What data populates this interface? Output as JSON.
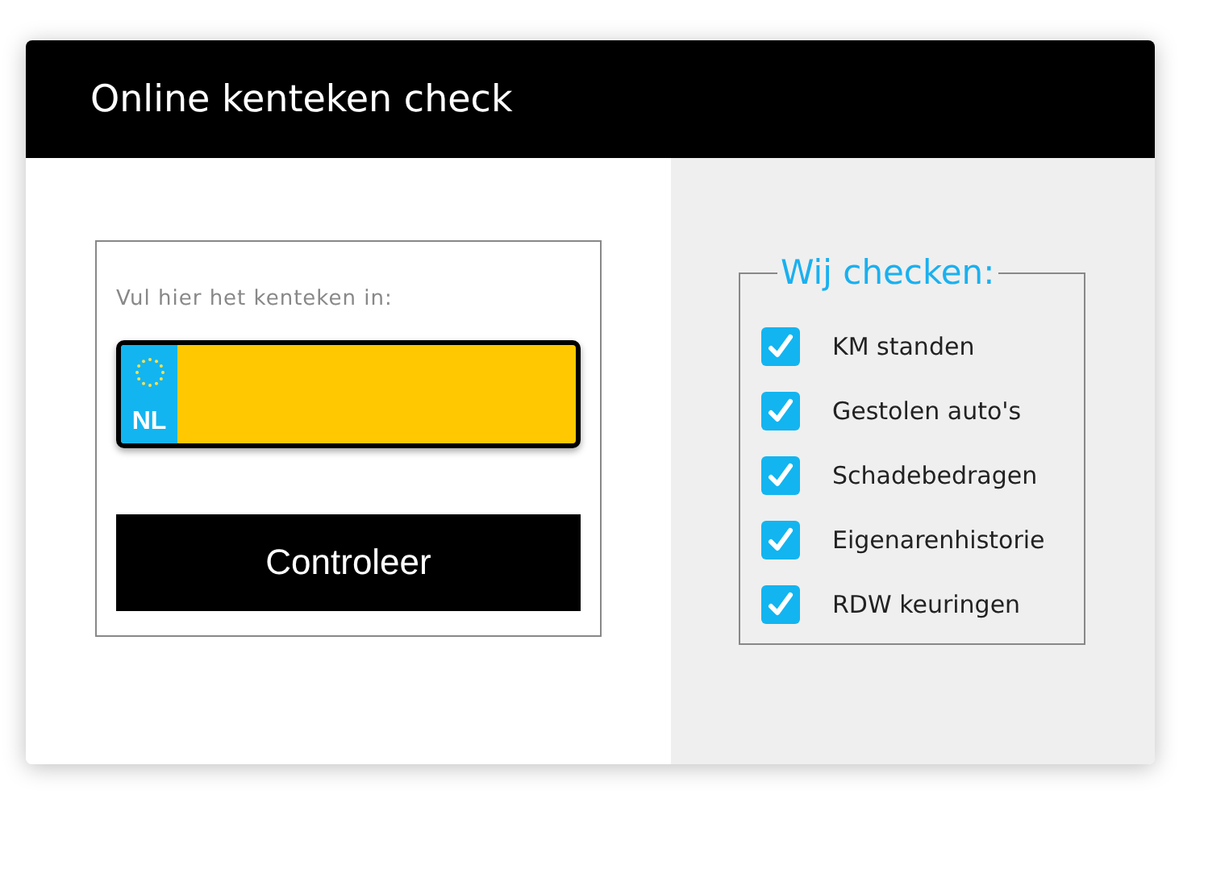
{
  "window": {
    "title": "Online kenteken check"
  },
  "form": {
    "label": "Vul hier het kenteken in:",
    "plate": {
      "country": "NL"
    },
    "button": "Controleer"
  },
  "checks": {
    "title": "Wij checken:",
    "items": [
      {
        "label": "KM standen",
        "checked": true
      },
      {
        "label": "Gestolen auto's",
        "checked": true
      },
      {
        "label": "Schadebedragen",
        "checked": true
      },
      {
        "label": "Eigenarenhistorie",
        "checked": true
      },
      {
        "label": "RDW keuringen",
        "checked": true
      }
    ]
  }
}
